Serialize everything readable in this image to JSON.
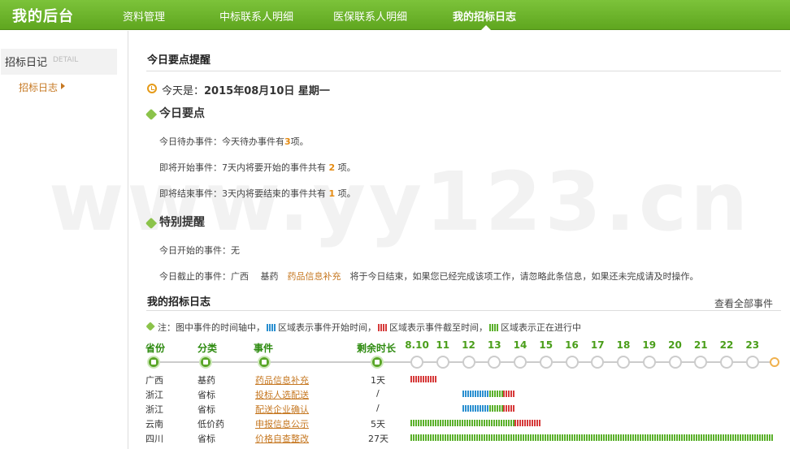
{
  "header": {
    "logo": "我的后台",
    "nav": [
      "资料管理",
      "中标联系人明细",
      "医保联系人明细",
      "我的招标日志"
    ],
    "active_nav": "我的招标日志"
  },
  "sidebar": {
    "title": "招标日记",
    "subtitle": "DETAIL",
    "link": "招标日志"
  },
  "reminder": {
    "title": "今日要点提醒",
    "today_prefix": "今天是：",
    "today": "2015年08月10日 星期一",
    "key_points_title": "今日要点",
    "todo_prefix": "今日待办事件：今天待办事件有",
    "todo_count": "3",
    "todo_suffix": "项。",
    "starting_prefix": "即将开始事件：7天内将要开始的事件共有",
    "starting_count": "2",
    "starting_suffix": "项。",
    "ending_prefix": "即将结束事件：3天内将要结束的事件共有",
    "ending_count": "1",
    "ending_suffix": "项。",
    "special_title": "特别提醒",
    "start_today": "今日开始的事件：无",
    "deadline_prefix": "今日截止的事件：广西　 基药",
    "deadline_event": "药品信息补充",
    "deadline_suffix": "将于今日结束，如果您已经完成该项工作，请忽略此条信息，如果还未完成请及时操作。"
  },
  "log": {
    "title": "我的招标日志",
    "view_all": "查看全部事件",
    "note_1": "注：图中事件的时间轴中，",
    "note_2": "区域表示事件开始时间，",
    "note_3": "区域表示事件截至时间，",
    "note_4": "区域表示正在进行中",
    "columns": [
      "省份",
      "分类",
      "事件",
      "剩余时长"
    ],
    "dates": [
      "8.10",
      "11",
      "12",
      "13",
      "14",
      "15",
      "16",
      "17",
      "18",
      "19",
      "20",
      "21",
      "22",
      "23"
    ],
    "rows": [
      {
        "province": "广西",
        "category": "基药",
        "event": "药品信息补充",
        "remaining": "1天"
      },
      {
        "province": "浙江",
        "category": "省标",
        "event": "投标人选配送",
        "remaining": "/"
      },
      {
        "province": "浙江",
        "category": "省标",
        "event": "配送企业确认",
        "remaining": "/"
      },
      {
        "province": "云南",
        "category": "低价药",
        "event": "申报信息公示",
        "remaining": "5天"
      },
      {
        "province": "四川",
        "category": "省标",
        "event": "价格自查整改",
        "remaining": "27天"
      }
    ]
  },
  "watermark": "www.yy123.cn",
  "colors": {
    "brand": "#6db52c",
    "link": "#c67822",
    "highlight": "#e58a10",
    "bar_ongoing": "#5ab02a",
    "bar_deadline": "#d63a3a",
    "bar_start": "#2a8fd0"
  }
}
